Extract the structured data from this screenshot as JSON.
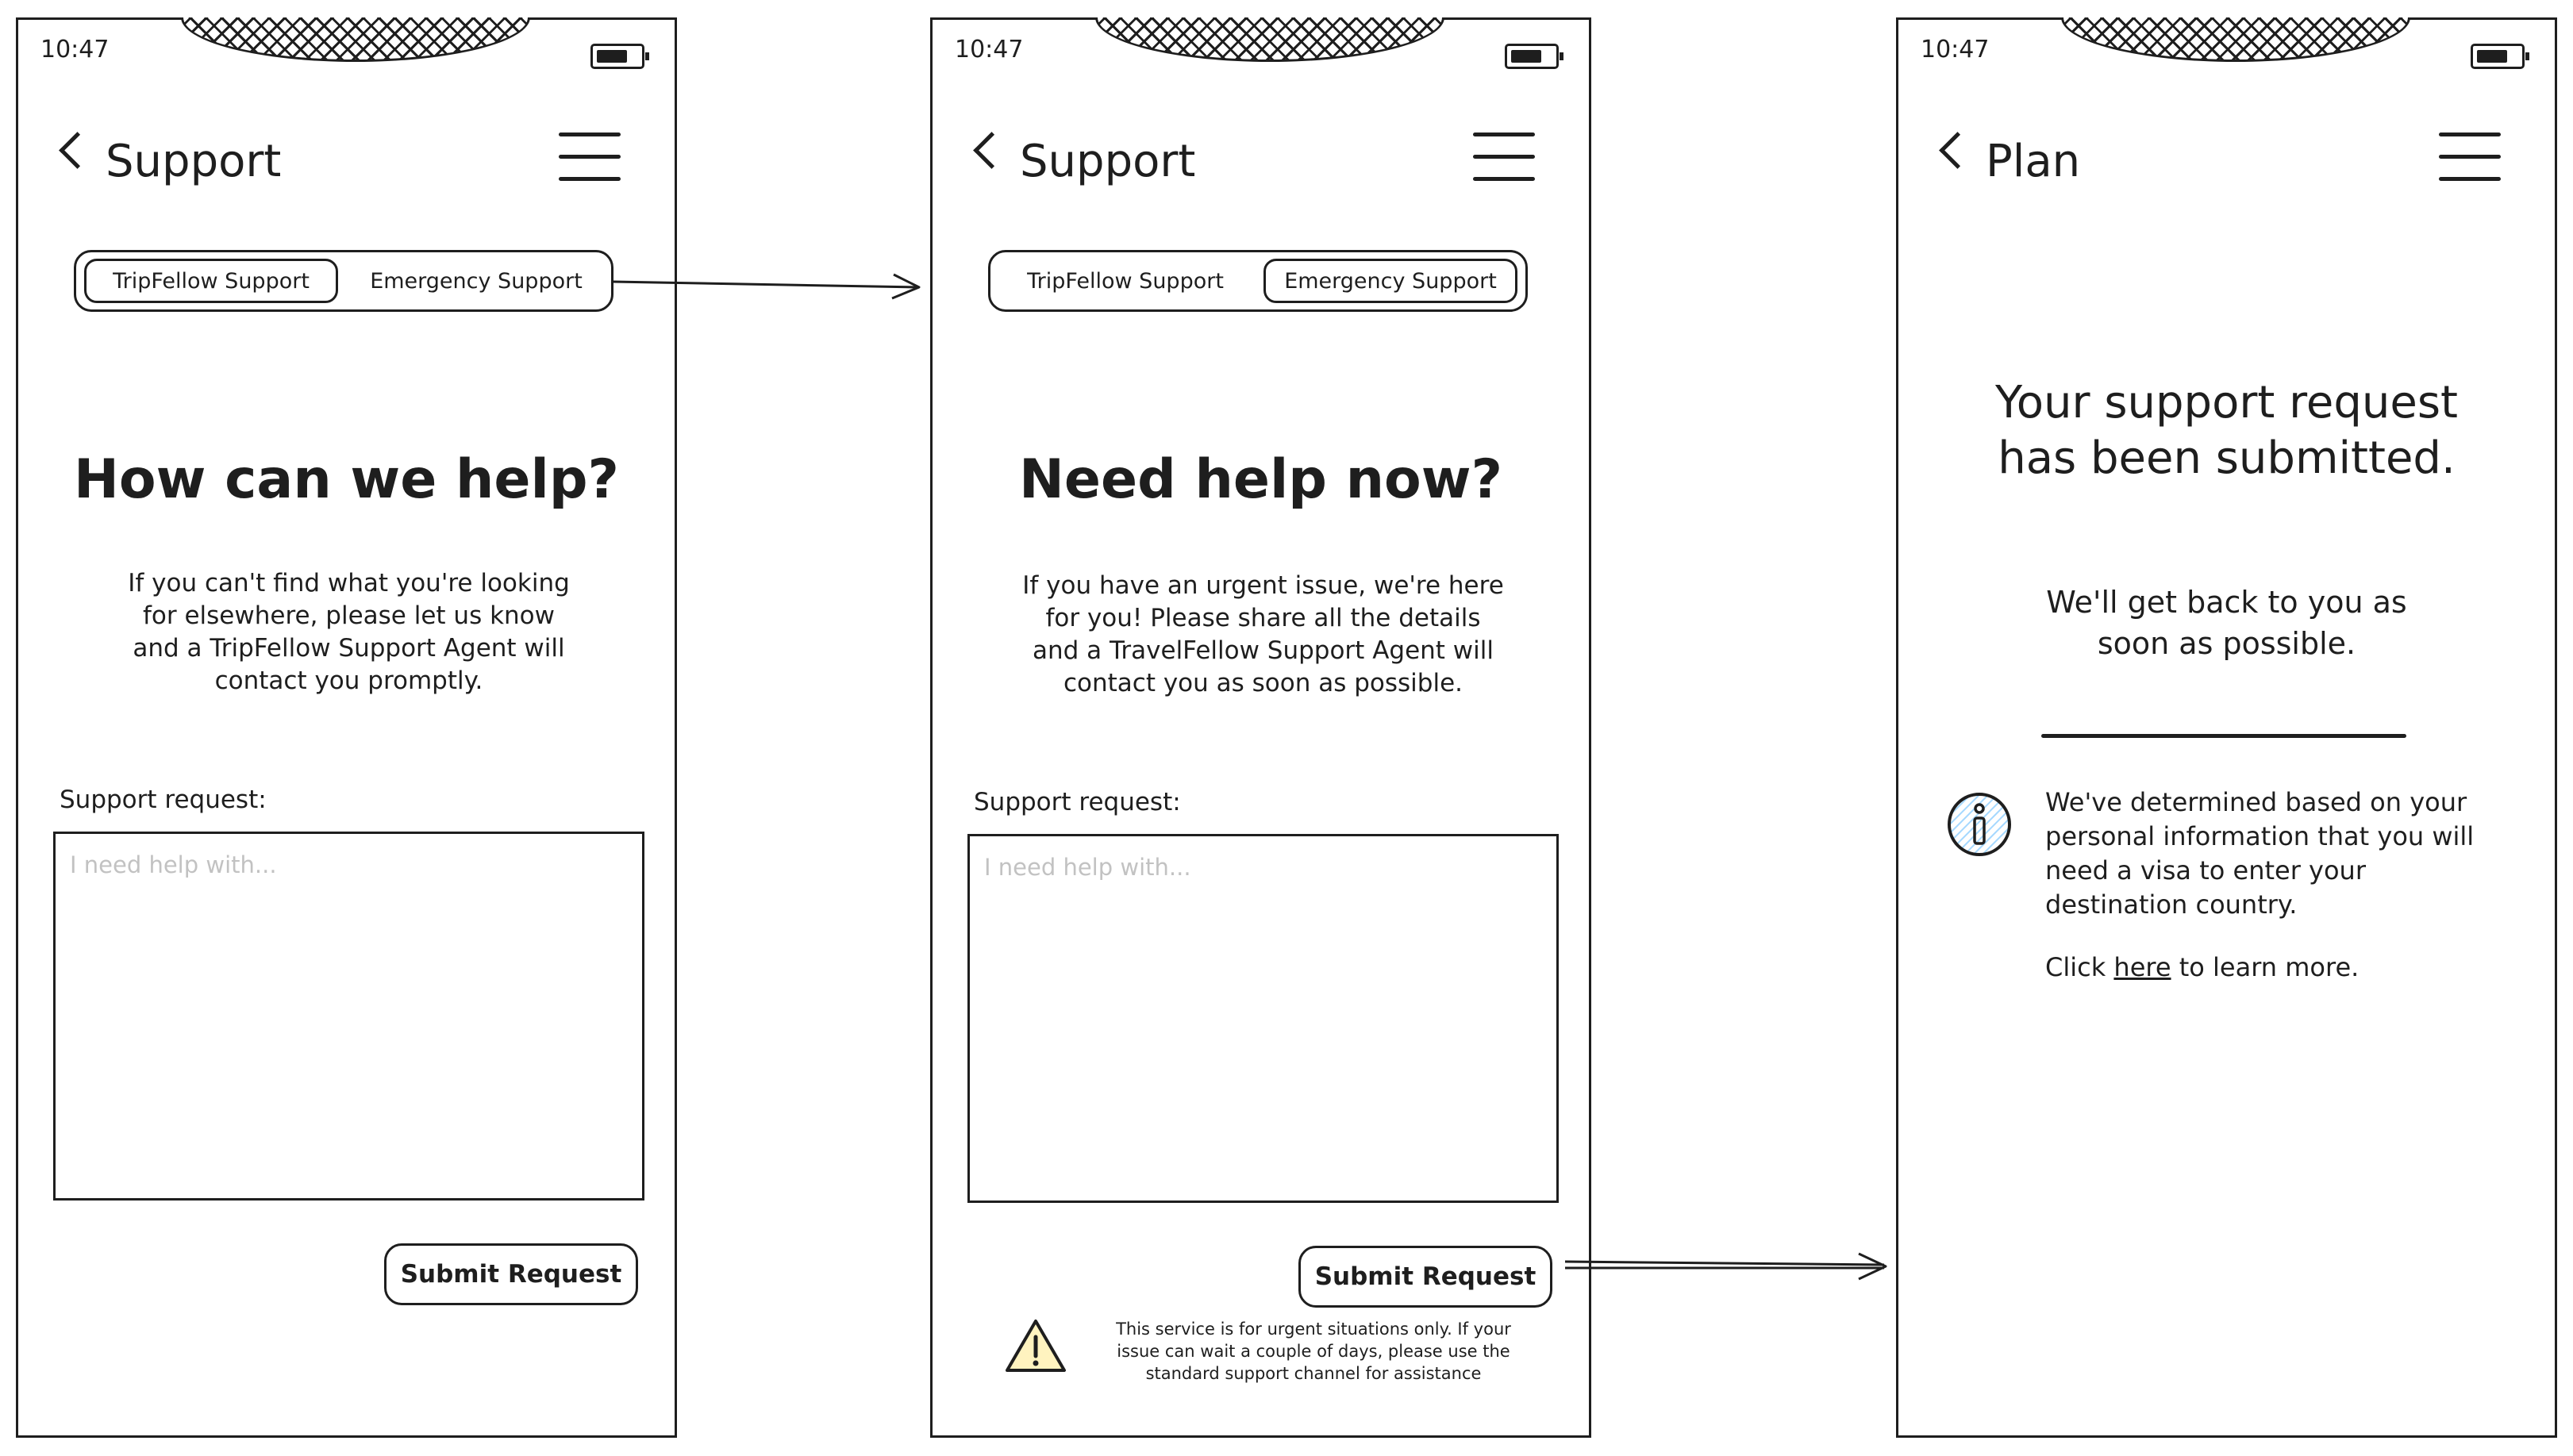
{
  "status_time": "10:47",
  "screens": [
    {
      "title": "Support",
      "tabs": [
        "TripFellow Support",
        "Emergency Support"
      ],
      "active_tab": 0,
      "heading": "How can we help?",
      "body_lines": [
        "If you can't find what you're looking",
        "for elsewhere, please let us know",
        "and a TripFellow Support Agent will",
        "contact you promptly."
      ],
      "field_label": "Support request:",
      "placeholder": "I need help with...",
      "submit_label": "Submit Request"
    },
    {
      "title": "Support",
      "tabs": [
        "TripFellow Support",
        "Emergency Support"
      ],
      "active_tab": 1,
      "heading": "Need help now?",
      "body_lines": [
        "If you have an urgent issue, we're here",
        "for you! Please share all the details",
        "and a TravelFellow Support Agent will",
        "contact you as soon as possible."
      ],
      "field_label": "Support request:",
      "placeholder": "I need help with...",
      "submit_label": "Submit Request",
      "warning_lines": [
        "This service is for urgent situations only. If your",
        "issue can wait a couple of days, please use the",
        "standard support channel for assistance"
      ]
    },
    {
      "title": "Plan",
      "heading_lines": [
        "Your support request",
        "has been submitted."
      ],
      "sub_lines": [
        "We'll get back to you as",
        "soon as possible."
      ],
      "info_lines": [
        "We've determined based on your",
        "personal information that you will",
        "need a visa to enter your",
        "destination country."
      ],
      "link_prefix": "Click ",
      "link_text": "here",
      "link_suffix": " to learn more."
    }
  ],
  "icons": {
    "back": "chevron-left-icon",
    "menu": "hamburger-menu-icon",
    "battery": "battery-icon",
    "warning": "warning-triangle-icon",
    "info": "info-circle-icon"
  },
  "colors": {
    "ink": "#1e1e1e",
    "placeholder": "#c2c2c2",
    "warning_fill": "#fff3bf",
    "info_fill": "#a5d8ff"
  }
}
